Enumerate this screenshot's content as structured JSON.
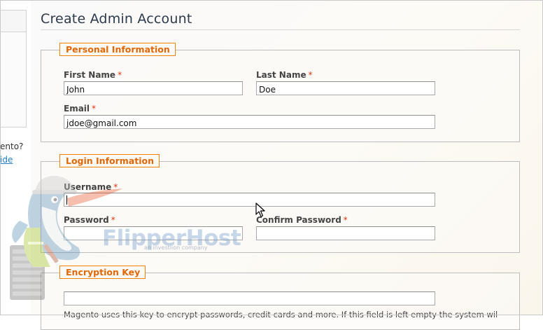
{
  "sidebar": {
    "question_text": "ento?",
    "link_text": "ide"
  },
  "page": {
    "title": "Create Admin Account"
  },
  "personal": {
    "legend": "Personal Information",
    "first_name": {
      "label": "First Name",
      "value": "John"
    },
    "last_name": {
      "label": "Last Name",
      "value": "Doe"
    },
    "email": {
      "label": "Email",
      "value": "jdoe@gmail.com"
    }
  },
  "login": {
    "legend": "Login Information",
    "username": {
      "label": "Username",
      "value": ""
    },
    "password": {
      "label": "Password",
      "value": ""
    },
    "confirm_password": {
      "label": "Confirm Password",
      "value": ""
    }
  },
  "encryption": {
    "legend": "Encryption Key",
    "value": "",
    "note": "Magento uses this key to encrypt passwords, credit cards and more. If this field is left empty the system will create an"
  },
  "required_marker": "*",
  "watermark": {
    "brand": "FlipperHost",
    "tagline": "an investlion company"
  },
  "colors": {
    "legend_border": "#f18200",
    "legend_text": "#e26703",
    "required": "#eb340a",
    "title": "#2b3a4a",
    "link": "#1e7ec8"
  },
  "icons": {
    "cursor": "mouse-pointer-icon"
  }
}
